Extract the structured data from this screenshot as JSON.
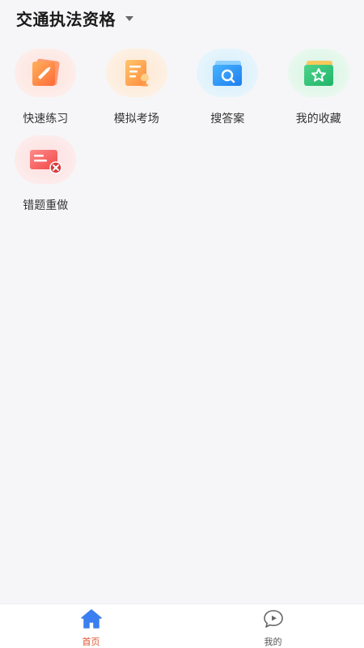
{
  "header": {
    "title": "交通执法资格"
  },
  "grid": {
    "items": [
      {
        "label": "快速练习",
        "icon": "pencil-card-icon"
      },
      {
        "label": "模拟考场",
        "icon": "exam-paper-icon"
      },
      {
        "label": "搜答案",
        "icon": "search-folder-icon"
      },
      {
        "label": "我的收藏",
        "icon": "star-folder-icon"
      },
      {
        "label": "错题重做",
        "icon": "error-card-icon"
      }
    ]
  },
  "bottom_nav": {
    "items": [
      {
        "label": "首页",
        "icon": "home-icon",
        "active": true
      },
      {
        "label": "我的",
        "icon": "chat-bubble-icon",
        "active": false
      }
    ]
  },
  "colors": {
    "accent": "#e0522f",
    "home_icon": "#3a7ff0",
    "background": "#f6f6f8"
  }
}
